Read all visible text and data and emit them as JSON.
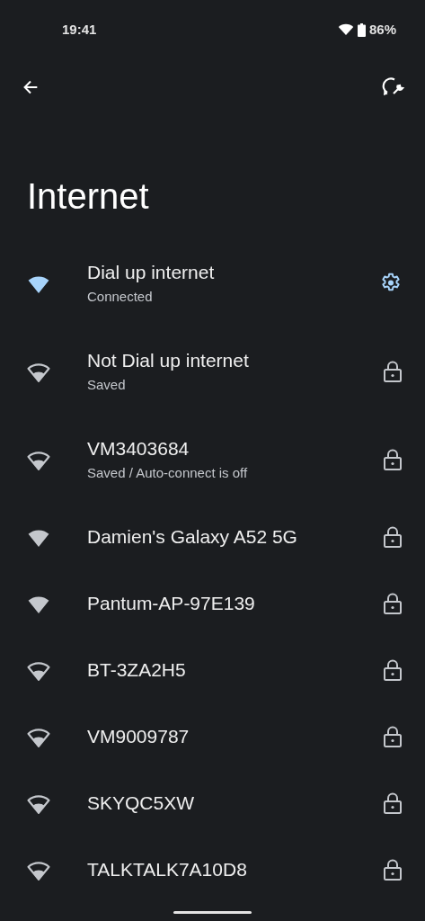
{
  "status_bar": {
    "time": "19:41",
    "battery": "86%"
  },
  "title": "Internet",
  "networks": [
    {
      "name": "Dial up internet",
      "status": "Connected",
      "connected": true,
      "kind": "full"
    },
    {
      "name": "Not Dial up internet",
      "status": "Saved",
      "connected": false,
      "kind": "partial"
    },
    {
      "name": "VM3403684",
      "status": "Saved / Auto-connect is off",
      "connected": false,
      "kind": "partial"
    },
    {
      "name": "Damien's Galaxy A52 5G",
      "connected": false,
      "kind": "full"
    },
    {
      "name": "Pantum-AP-97E139",
      "connected": false,
      "kind": "full"
    },
    {
      "name": "BT-3ZA2H5",
      "connected": false,
      "kind": "partial"
    },
    {
      "name": "VM9009787",
      "connected": false,
      "kind": "partial"
    },
    {
      "name": "SKYQC5XW",
      "connected": false,
      "kind": "partial"
    },
    {
      "name": "TALKTALK7A10D8",
      "connected": false,
      "kind": "partial"
    }
  ]
}
